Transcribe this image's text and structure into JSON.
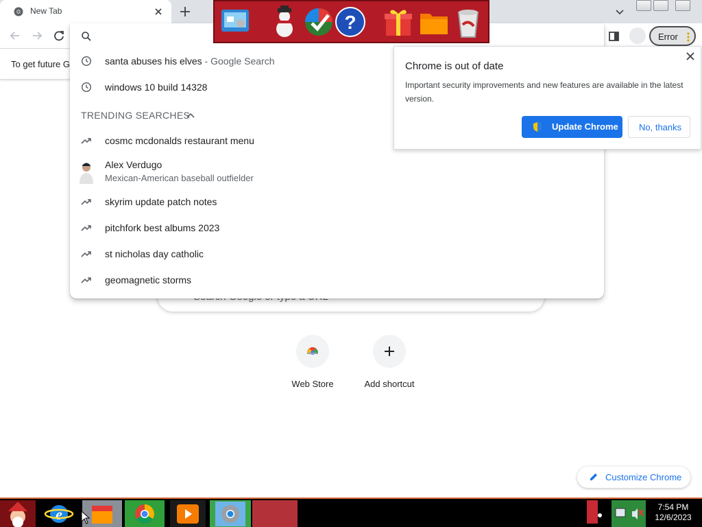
{
  "browser": {
    "tab_title": "New Tab",
    "toolbar_error_label": "Error",
    "infobar_text": "To get future G"
  },
  "omnibox": {
    "history": [
      {
        "text": "santa abuses his elves",
        "suffix": " - Google Search"
      },
      {
        "text": "windows 10 build 14328",
        "suffix": ""
      }
    ],
    "trending_header": "TRENDING SEARCHES",
    "trending": [
      "cosmc mcdonalds restaurant menu",
      "skyrim update patch notes",
      "pitchfork best albums 2023",
      "st nicholas day catholic",
      "geomagnetic storms"
    ],
    "entity": {
      "name": "Alex Verdugo",
      "description": "Mexican-American baseball outfielder"
    }
  },
  "popup": {
    "title": "Chrome is out of date",
    "body": "Important security improvements and new features are available in the latest version.",
    "update_button": "Update Chrome",
    "no_button": "No, thanks"
  },
  "ntp": {
    "search_placeholder": "Search Google or type a URL",
    "shortcuts": [
      {
        "label": "Web Store"
      },
      {
        "label": "Add shortcut"
      }
    ],
    "customize_label": "Customize Chrome"
  },
  "taskbar": {
    "time": "7:54 PM",
    "date": "12/6/2023"
  },
  "colors": {
    "accent": "#1a73e8",
    "deskbar": "#b31c27"
  }
}
